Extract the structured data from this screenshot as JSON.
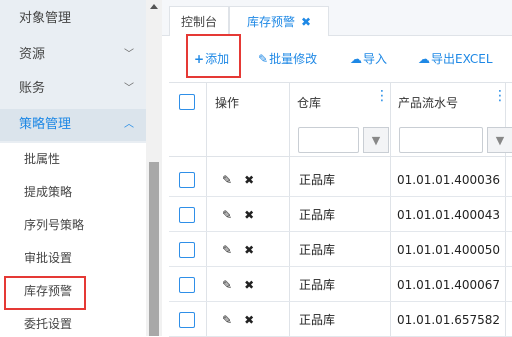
{
  "sidebar": {
    "items": [
      {
        "label": "对象管理",
        "chevron": ""
      },
      {
        "label": "资源",
        "chevron": "﹀"
      },
      {
        "label": "账务",
        "chevron": "﹀"
      },
      {
        "label": "策略管理",
        "chevron": "︿"
      }
    ],
    "subitems": [
      {
        "label": "批属性"
      },
      {
        "label": "提成策略"
      },
      {
        "label": "序列号策略"
      },
      {
        "label": "审批设置"
      },
      {
        "label": "库存预警"
      },
      {
        "label": "委托设置"
      }
    ]
  },
  "tabs": [
    {
      "label": "控制台"
    },
    {
      "label": "库存预警",
      "close": "✖"
    }
  ],
  "toolbar": {
    "add": {
      "icon": "+",
      "label": "添加"
    },
    "batch_edit": {
      "icon": "✎",
      "label": "批量修改"
    },
    "import": {
      "icon": "☁",
      "label": "导入"
    },
    "export": {
      "icon": "☁",
      "label": "导出EXCEL"
    }
  },
  "table": {
    "headers": {
      "action": "操作",
      "warehouse": "仓库",
      "serial": "产品流水号"
    },
    "rows": [
      {
        "edit": "✎",
        "delete": "✖",
        "warehouse": "正品库",
        "serial": "01.01.01.400036"
      },
      {
        "edit": "✎",
        "delete": "✖",
        "warehouse": "正品库",
        "serial": "01.01.01.400043"
      },
      {
        "edit": "✎",
        "delete": "✖",
        "warehouse": "正品库",
        "serial": "01.01.01.400050"
      },
      {
        "edit": "✎",
        "delete": "✖",
        "warehouse": "正品库",
        "serial": "01.01.01.400067"
      },
      {
        "edit": "✎",
        "delete": "✖",
        "warehouse": "正品库",
        "serial": "01.01.01.657582"
      }
    ]
  },
  "colors": {
    "accent": "#1e88e5",
    "highlight": "#e53935"
  }
}
